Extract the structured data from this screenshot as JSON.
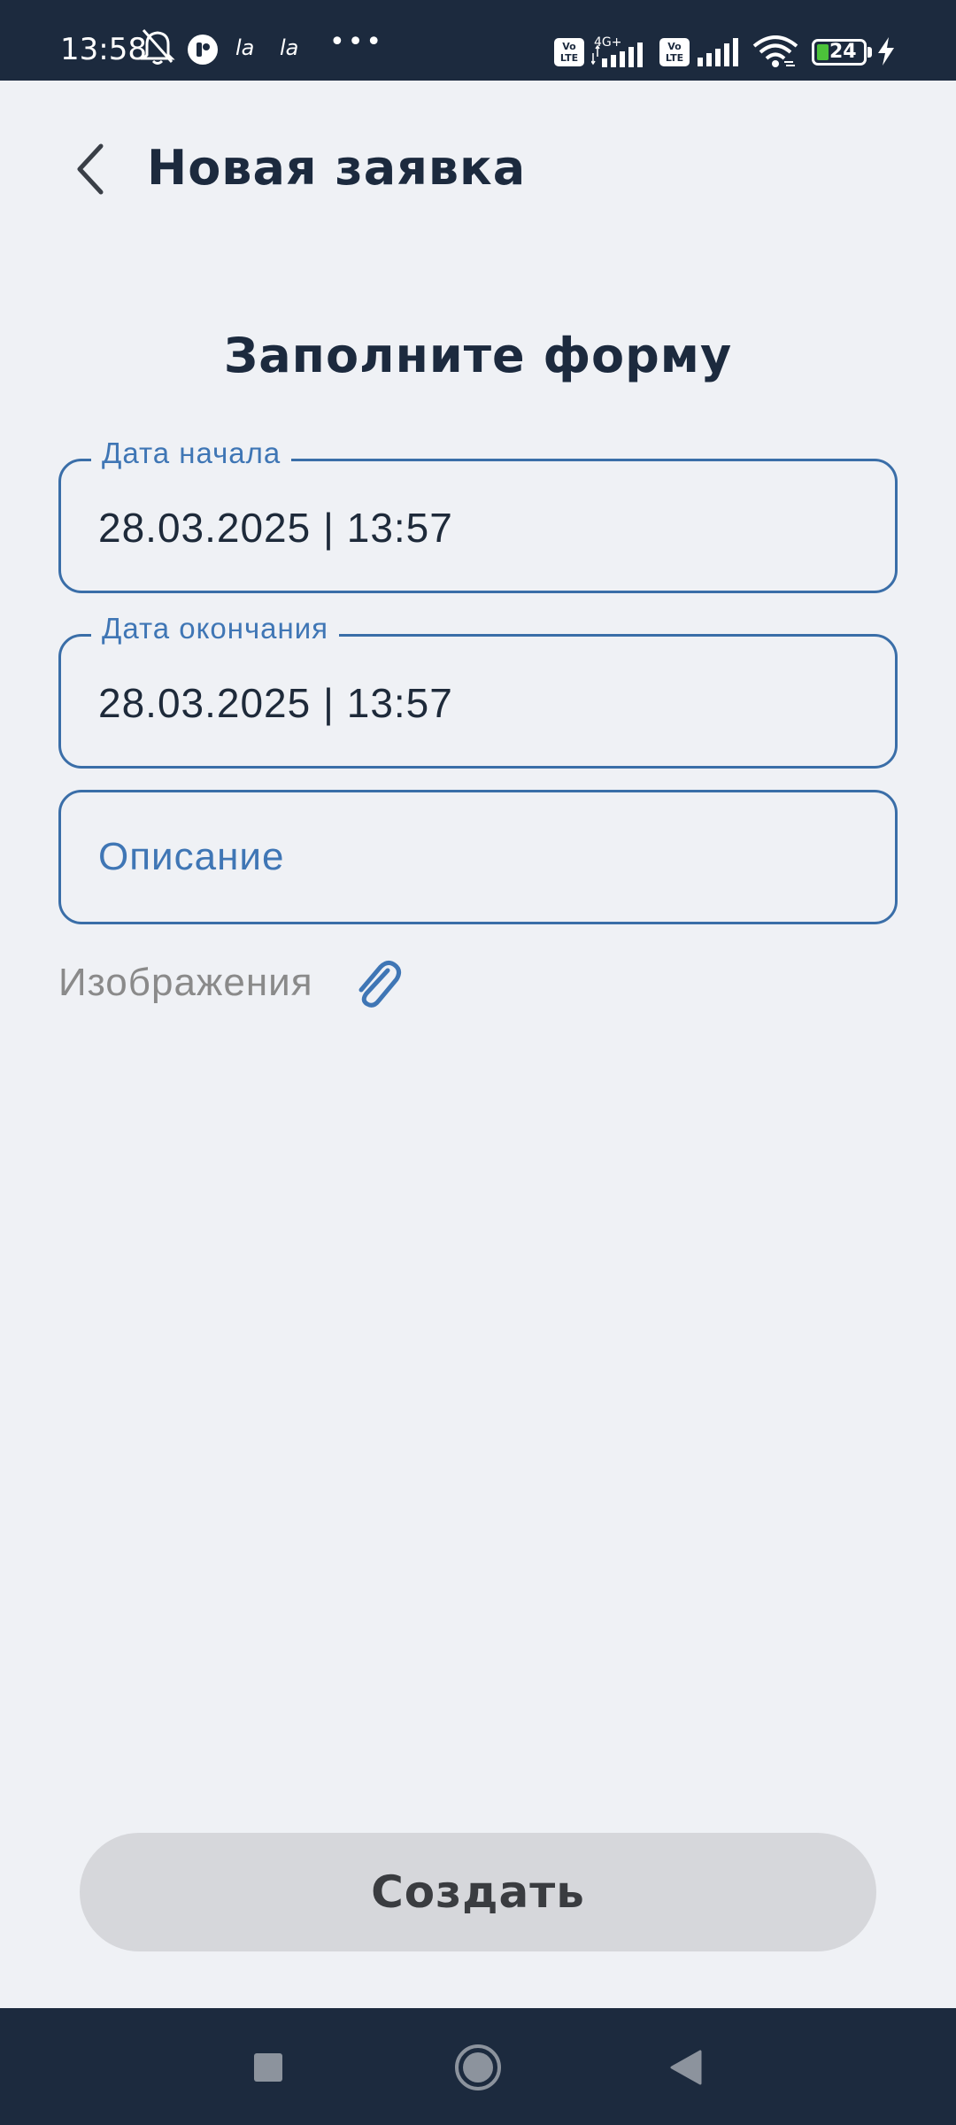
{
  "status_bar": {
    "time": "13:58",
    "icons": [
      "bell-off-icon",
      "app-notification-icon",
      "la-icon",
      "la-icon",
      "more-dots-icon",
      "volte-icon",
      "signal-icon",
      "volte-icon",
      "signal-icon",
      "wifi-icon",
      "battery-icon",
      "charging-icon"
    ],
    "app_text_1": "la",
    "app_text_2": "la",
    "dots": "•••",
    "volte_1": "Vo\nLTE",
    "volte_2": "Vo\nLTE",
    "network_type": "4G+",
    "battery_level": "24",
    "battery_fraction": 0.24
  },
  "header": {
    "title": "Новая заявка",
    "back_icon": "chevron-left-icon"
  },
  "form": {
    "heading": "Заполните форму",
    "start_date": {
      "label": "Дата начала",
      "value": "28.03.2025 | 13:57"
    },
    "end_date": {
      "label": "Дата окончания",
      "value": "28.03.2025 | 13:57"
    },
    "description": {
      "placeholder": "Описание"
    },
    "images": {
      "label": "Изображения",
      "icon": "paperclip-icon"
    },
    "submit_label": "Создать"
  },
  "navigation_bar": {
    "buttons": [
      "recents-square-icon",
      "home-circle-icon",
      "back-triangle-icon"
    ]
  },
  "colors": {
    "dark": "#1c2a3e",
    "accent": "#3a6ea8",
    "background": "#eff1f5",
    "button_disabled": "#d6d7db"
  }
}
